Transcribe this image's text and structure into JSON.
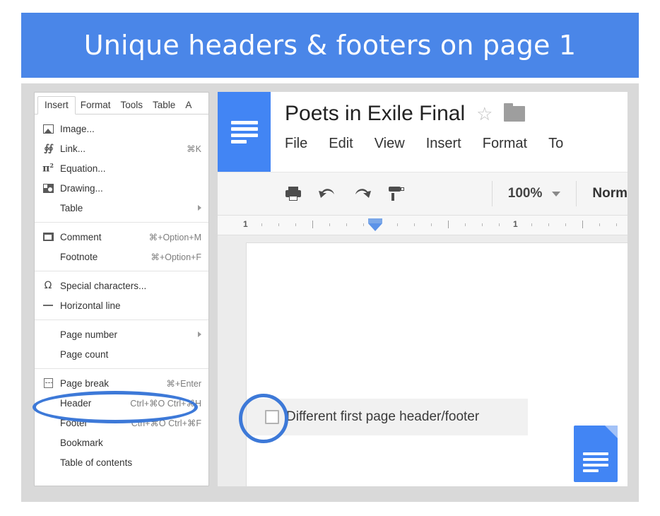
{
  "banner": {
    "title": "Unique headers & footers on page 1",
    "background_color": "#4a86e8",
    "text_color": "#ffffff"
  },
  "insert_menu_panel": {
    "menubar": [
      {
        "label": "Insert",
        "active": true
      },
      {
        "label": "Format",
        "active": false
      },
      {
        "label": "Tools",
        "active": false
      },
      {
        "label": "Table",
        "active": false
      },
      {
        "label": "A",
        "active": false
      }
    ],
    "sections": [
      {
        "items": [
          {
            "label": "Image...",
            "shortcut": "",
            "icon": "image-icon",
            "submenu": false
          },
          {
            "label": "Link...",
            "shortcut": "⌘K",
            "icon": "link-icon",
            "submenu": false
          },
          {
            "label": "Equation...",
            "shortcut": "",
            "icon": "equation-icon",
            "submenu": false
          },
          {
            "label": "Drawing...",
            "shortcut": "",
            "icon": "drawing-icon",
            "submenu": false
          },
          {
            "label": "Table",
            "shortcut": "",
            "icon": "",
            "submenu": true
          }
        ]
      },
      {
        "items": [
          {
            "label": "Comment",
            "shortcut": "⌘+Option+M",
            "icon": "comment-icon",
            "submenu": false
          },
          {
            "label": "Footnote",
            "shortcut": "⌘+Option+F",
            "icon": "",
            "submenu": false
          }
        ]
      },
      {
        "items": [
          {
            "label": "Special characters...",
            "shortcut": "",
            "icon": "omega-icon",
            "submenu": false
          },
          {
            "label": "Horizontal line",
            "shortcut": "",
            "icon": "horizontal-line-icon",
            "submenu": false
          }
        ]
      },
      {
        "items": [
          {
            "label": "Page number",
            "shortcut": "",
            "icon": "",
            "submenu": true
          },
          {
            "label": "Page count",
            "shortcut": "",
            "icon": "",
            "submenu": false
          }
        ]
      },
      {
        "items": [
          {
            "label": "Page break",
            "shortcut": "⌘+Enter",
            "icon": "page-break-icon",
            "submenu": false
          },
          {
            "label": "Header",
            "shortcut": "Ctrl+⌘O Ctrl+⌘H",
            "icon": "",
            "submenu": false
          },
          {
            "label": "Footer",
            "shortcut": "Ctrl+⌘O Ctrl+⌘F",
            "icon": "",
            "submenu": false
          },
          {
            "label": "Bookmark",
            "shortcut": "",
            "icon": "",
            "submenu": false
          },
          {
            "label": "Table of contents",
            "shortcut": "",
            "icon": "",
            "submenu": false
          }
        ]
      }
    ]
  },
  "docs_window": {
    "app_icon": "google-docs-icon",
    "document_title": "Poets in Exile Final",
    "star_glyph": "☆",
    "menubar": [
      "File",
      "Edit",
      "View",
      "Insert",
      "Format",
      "To"
    ],
    "toolbar": {
      "icons": [
        "print-icon",
        "undo-icon",
        "redo-icon",
        "paint-format-icon"
      ],
      "zoom_level": "100%",
      "paragraph_style": "Norm"
    },
    "ruler": {
      "left_number": "1",
      "right_number": "1"
    },
    "page": {
      "first_page_option_label": "Different first page header/footer",
      "first_page_option_checked": false
    }
  },
  "annotations": {
    "color": "#3d79d8",
    "shapes": [
      {
        "name": "header-menu-item-highlight",
        "target": "Header"
      },
      {
        "name": "first-page-checkbox-highlight",
        "target": "Different first page header/footer"
      }
    ]
  }
}
